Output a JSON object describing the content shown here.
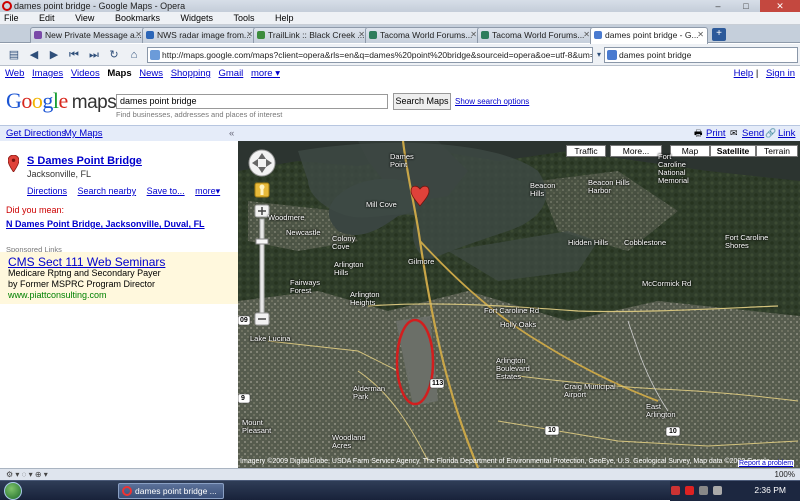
{
  "window": {
    "title": "dames point bridge - Google Maps - Opera",
    "controls": [
      "–",
      "□",
      "✕"
    ]
  },
  "menu": [
    "File",
    "Edit",
    "View",
    "Bookmarks",
    "Widgets",
    "Tools",
    "Help"
  ],
  "tabs": [
    {
      "label": "New Private Message a...",
      "active": false
    },
    {
      "label": "NWS radar image from...",
      "active": false
    },
    {
      "label": "TrailLink :: Black Creek ...",
      "active": false
    },
    {
      "label": "Tacoma World Forums...",
      "active": false
    },
    {
      "label": "Tacoma World Forums...",
      "active": false
    },
    {
      "label": "dames point bridge - G...",
      "active": true
    }
  ],
  "address": {
    "url": "http://maps.google.com/maps?client=opera&rls=en&q=dames%20point%20bridge&sourceid=opera&oe=utf-8&um=1&ie=U"
  },
  "search_box": {
    "value": "dames point bridge"
  },
  "google_nav": {
    "items": [
      "Web",
      "Images",
      "Videos",
      "Maps",
      "News",
      "Shopping",
      "Gmail",
      "more ▾"
    ],
    "help": "Help",
    "signin": "Sign in"
  },
  "logo": {
    "maps_word": "maps"
  },
  "query": {
    "value": "dames point bridge",
    "button": "Search Maps",
    "options": "Show search options",
    "hint": "Find businesses, addresses and places of interest"
  },
  "linkbar": {
    "get_directions": "Get Directions",
    "my_maps": "My Maps",
    "collapse": "«",
    "print": "Print",
    "send": "Send",
    "link": "Link"
  },
  "result": {
    "title": "S Dames Point Bridge",
    "subtitle": "Jacksonville, FL",
    "links": [
      "Directions",
      "Search nearby",
      "Save to...",
      "more▾"
    ],
    "did_you_mean": "Did you mean:",
    "did_you_mean_link": "N Dames Point Bridge, Jacksonville, Duval, FL"
  },
  "sponsored": {
    "label": "Sponsored Links",
    "title": "CMS Sect 111 Web Seminars",
    "line1": "Medicare Rptng and Secondary Payer",
    "line2": "by Former MSPRC Program Director",
    "url": "www.piattconsulting.com"
  },
  "map": {
    "buttons": {
      "traffic": "Traffic",
      "more": "More...",
      "map": "Map",
      "satellite": "Satellite",
      "terrain": "Terrain"
    },
    "active_view": "Satellite",
    "labels": {
      "dames_point": "Dames\nPoint",
      "mill_cove": "Mill Cove",
      "woodmere": "Woodmere",
      "newcastle": "Newcastle",
      "colony_cove": "Colony\nCove",
      "gilmore": "Gilmore",
      "arlington_hills": "Arlington\nHills",
      "fairways_forest": "Fairways\nForest",
      "arlington_heights": "Arlington\nHeights",
      "lake_lucina": "Lake Lucina",
      "beacon_hills": "Beacon\nHills",
      "beacon_hills_harbor": "Beacon Hills\nHarbor",
      "hidden_hills": "Hidden Hills",
      "cobblestone": "Cobblestone",
      "fort_caroline_nm": "Fort\nCaroline\nNational\nMemorial",
      "fort_caroline_shores": "Fort Caroline\nShores",
      "fort_caroline_rd": "Fort Caroline Rd",
      "mccormick_rd": "McCormick Rd",
      "holly_oaks": "Holly Oaks",
      "arlington_boulevard_estates": "Arlington\nBoulevard\nEstates",
      "craig_municipal": "Craig Municipal\nAirport",
      "alderman_park": "Alderman\nPark",
      "woodland_acres": "Woodland\nAcres",
      "east_arlington": "East\nArlington",
      "mount_pleasant": "Mount\nPleasant",
      "route_113": "113",
      "route_10a": "10",
      "route_10b": "10",
      "route_9": "9",
      "route_109": "09"
    },
    "attribution": "Imagery ©2009 DigitalGlobe, USDA Farm Service Agency, The Florida Department of Environmental Protection, GeoEye, U.S. Geological Survey, Map data ©2009 Google",
    "report": "Report a problem"
  },
  "status": {
    "zoom": "100%"
  },
  "taskbar": {
    "item": "dames point bridge ...",
    "clock": "2:36 PM"
  },
  "colors": {
    "link": "#0000cc",
    "accent_red": "#cc0000",
    "sponsor_bg": "#fff8dd"
  },
  "icons": [
    "opera-icon",
    "back-icon",
    "forward-icon",
    "rewind-icon",
    "fastforward-icon",
    "reload-icon",
    "home-icon",
    "printer-icon",
    "envelope-icon",
    "link-icon",
    "map-pin-icon",
    "pan-control-icon",
    "zoom-in-icon",
    "zoom-out-icon",
    "pegman-icon",
    "windows-start-icon"
  ]
}
